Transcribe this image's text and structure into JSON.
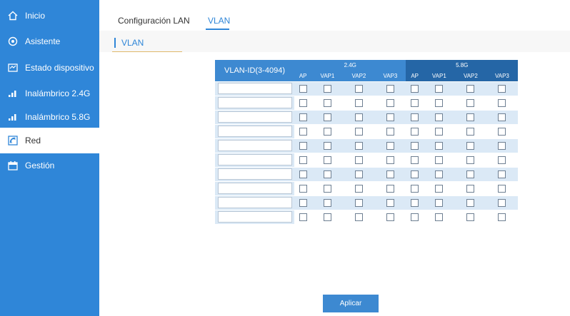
{
  "sidebar": {
    "items": [
      {
        "label": "Inicio",
        "icon": "home-icon",
        "active": false
      },
      {
        "label": "Asistente",
        "icon": "wizard-icon",
        "active": false
      },
      {
        "label": "Estado dispositivo",
        "icon": "status-icon",
        "active": false
      },
      {
        "label": "Inalámbrico 2.4G",
        "icon": "signal-icon",
        "active": false
      },
      {
        "label": "Inalámbrico 5.8G",
        "icon": "signal-icon",
        "active": false
      },
      {
        "label": "Red",
        "icon": "network-icon",
        "active": true
      },
      {
        "label": "Gestión",
        "icon": "calendar-icon",
        "active": false
      }
    ]
  },
  "tabs": [
    {
      "label": "Configuración LAN",
      "active": false
    },
    {
      "label": "VLAN",
      "active": true
    }
  ],
  "section": {
    "title": "VLAN"
  },
  "table": {
    "id_header": "VLAN-ID(3-4094)",
    "band_24": "2.4G",
    "band_58": "5.8G",
    "columns": [
      "AP",
      "VAP1",
      "VAP2",
      "VAP3",
      "AP",
      "VAP1",
      "VAP2",
      "VAP3"
    ],
    "rows": [
      "",
      "",
      "",
      "",
      "",
      "",
      "",
      "",
      "",
      ""
    ]
  },
  "apply_label": "Aplicar",
  "colors": {
    "sidebar_bg": "#2f86d8",
    "accent": "#2f86d8",
    "table_header": "#3d89d1",
    "row_alt": "#dbe9f6"
  }
}
